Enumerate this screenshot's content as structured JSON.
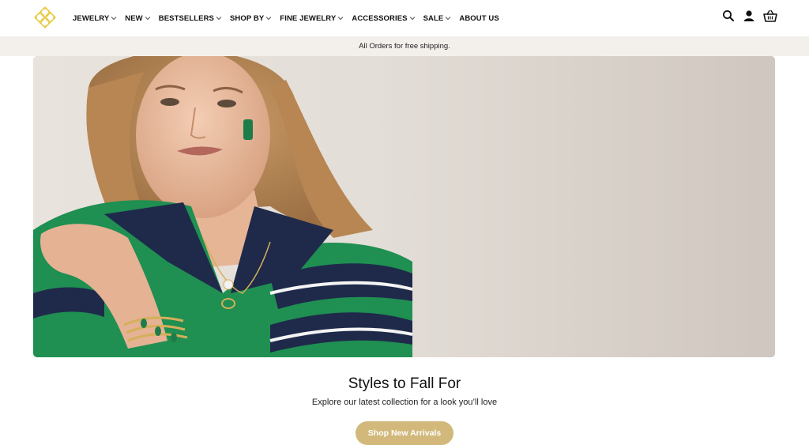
{
  "brand": {
    "logo_icon": "kendra-scott-logo-icon",
    "accent_color": "#e7c83b"
  },
  "nav": {
    "items": [
      {
        "label": "JEWELRY",
        "has_dropdown": true
      },
      {
        "label": "NEW",
        "has_dropdown": true
      },
      {
        "label": "BESTSELLERS",
        "has_dropdown": true
      },
      {
        "label": "SHOP BY",
        "has_dropdown": true
      },
      {
        "label": "FINE JEWELRY",
        "has_dropdown": true
      },
      {
        "label": "ACCESSORIES",
        "has_dropdown": true
      },
      {
        "label": "SALE",
        "has_dropdown": true
      },
      {
        "label": "ABOUT US",
        "has_dropdown": false
      }
    ]
  },
  "header_icons": [
    "search-icon",
    "account-icon",
    "basket-icon"
  ],
  "promo_bar": {
    "text": "All Orders for free shipping."
  },
  "hero": {
    "image": "model-in-green-striped-sweater-with-jewelry"
  },
  "promo": {
    "title": "Styles to Fall For",
    "subtitle": "Explore our latest collection for a look you’ll love",
    "cta_label": "Shop New Arrivals",
    "cta_color": "#d2b97b"
  }
}
